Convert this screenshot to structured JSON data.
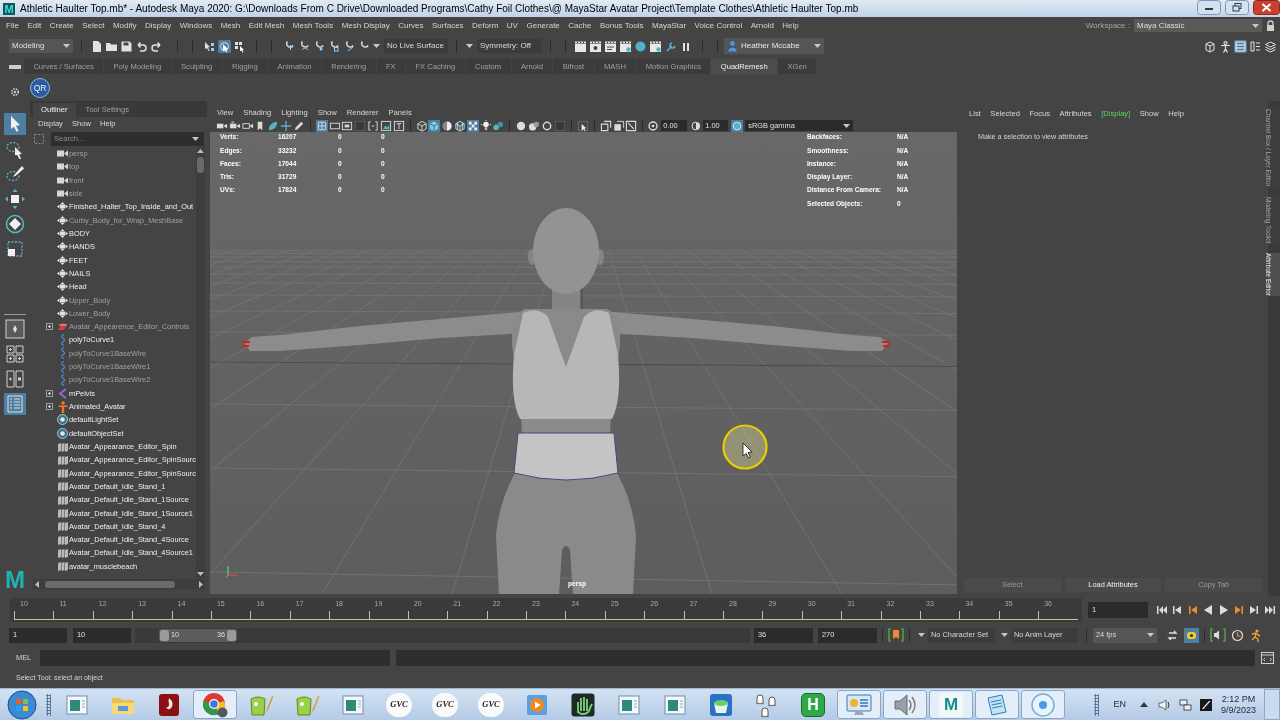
{
  "window": {
    "logo": "M",
    "title": "Athletic Haulter Top.mb* - Autodesk Maya 2020: G:\\Downloads From C Drive\\Downloaded Programs\\Cathy Foil Clothes\\@ MayaStar Avatar Project\\Template Clothes\\Athletic Haulter Top.mb"
  },
  "menu_bar": [
    "File",
    "Edit",
    "Create",
    "Select",
    "Modify",
    "Display",
    "Windows",
    "Mesh",
    "Edit Mesh",
    "Mesh Tools",
    "Mesh Display",
    "Curves",
    "Surfaces",
    "Deform",
    "UV",
    "Generate",
    "Cache",
    "Bonus Tools",
    "MayaStar",
    "Voice Control",
    "Arnold",
    "Help"
  ],
  "workspace": {
    "label": "Workspace :",
    "value": "Maya Classic"
  },
  "status_line": {
    "menu_set": "Modeling",
    "select_modes": [
      {
        "selected": false
      },
      {
        "selected": true
      },
      {
        "selected": false
      }
    ],
    "live_surface": "No Live Surface",
    "symmetry": "Symmetry: Off",
    "user": "Heather Mccabe",
    "panel_toggles": [
      {
        "selected": false
      },
      {
        "selected": false
      },
      {
        "selected": true
      },
      {
        "selected": false
      },
      {
        "selected": false
      }
    ]
  },
  "shelf": {
    "tabs": [
      {
        "label": "Curves / Surfaces",
        "selected": false
      },
      {
        "label": "Poly Modeling",
        "selected": false
      },
      {
        "label": "Sculpting",
        "selected": false
      },
      {
        "label": "Rigging",
        "selected": false
      },
      {
        "label": "Animation",
        "selected": false
      },
      {
        "label": "Rendering",
        "selected": false
      },
      {
        "label": "FX",
        "selected": false
      },
      {
        "label": "FX Caching",
        "selected": false
      },
      {
        "label": "Custom",
        "selected": false
      },
      {
        "label": "Arnold",
        "selected": false
      },
      {
        "label": "Bifrost",
        "selected": false
      },
      {
        "label": "MASH",
        "selected": false
      },
      {
        "label": "Motion Graphics",
        "selected": false
      },
      {
        "label": "QuadRemesh",
        "selected": true
      },
      {
        "label": "XGen",
        "selected": false
      }
    ],
    "buttons": [
      "QR"
    ]
  },
  "toolbox": {
    "tools": [
      {
        "selected": true
      },
      {
        "selected": false
      },
      {
        "selected": false
      },
      {
        "selected": false
      },
      {
        "selected": false
      },
      {
        "selected": false
      }
    ],
    "layouts": [
      {
        "selected": false
      },
      {
        "selected": false
      },
      {
        "selected": false
      },
      {
        "selected": true
      }
    ],
    "logo": "M"
  },
  "outliner": {
    "tabs": [
      {
        "label": "Outliner",
        "selected": true
      },
      {
        "label": "Tool Settings",
        "selected": false
      }
    ],
    "menu": [
      "Display",
      "Show",
      "Help"
    ],
    "search": {
      "placeholder": "Search..."
    },
    "items": [
      {
        "kind": "camera",
        "label": "persp",
        "hidden": true,
        "expandable": false
      },
      {
        "kind": "camera",
        "label": "top",
        "hidden": true,
        "expandable": false
      },
      {
        "kind": "camera",
        "label": "front",
        "hidden": true,
        "expandable": false
      },
      {
        "kind": "camera",
        "label": "side",
        "hidden": true,
        "expandable": false
      },
      {
        "kind": "mesh",
        "label": "Finished_Halter_Top_Inside_and_Out",
        "hidden": false,
        "expandable": false
      },
      {
        "kind": "mesh",
        "label": "Curby_Body_for_Wrap_MeshBase",
        "hidden": true,
        "expandable": false
      },
      {
        "kind": "mesh",
        "label": "BODY",
        "hidden": false,
        "expandable": false
      },
      {
        "kind": "mesh",
        "label": "HANDS",
        "hidden": false,
        "expandable": false
      },
      {
        "kind": "mesh",
        "label": "FEET",
        "hidden": false,
        "expandable": false
      },
      {
        "kind": "mesh",
        "label": "NAILS",
        "hidden": false,
        "expandable": false
      },
      {
        "kind": "mesh",
        "label": "Head",
        "hidden": false,
        "expandable": false
      },
      {
        "kind": "mesh",
        "label": "Upper_Body",
        "hidden": true,
        "expandable": false
      },
      {
        "kind": "mesh",
        "label": "Lower_Body",
        "hidden": true,
        "expandable": false
      },
      {
        "kind": "controls",
        "label": "Avatar_Appearence_Editor_Controls",
        "hidden": true,
        "expandable": true
      },
      {
        "kind": "curve",
        "label": "polyToCurve1",
        "hidden": false,
        "expandable": false
      },
      {
        "kind": "curve",
        "label": "polyToCurve1BaseWire",
        "hidden": true,
        "expandable": false
      },
      {
        "kind": "curve",
        "label": "polyToCurve1BaseWire1",
        "hidden": true,
        "expandable": false
      },
      {
        "kind": "curve",
        "label": "polyToCurve1BaseWire2",
        "hidden": true,
        "expandable": false
      },
      {
        "kind": "joint",
        "label": "mPelvis",
        "hidden": false,
        "expandable": true
      },
      {
        "kind": "figure",
        "label": "Animated_Avatar",
        "hidden": false,
        "expandable": true
      },
      {
        "kind": "set",
        "label": "defaultLightSet",
        "hidden": false,
        "expandable": false
      },
      {
        "kind": "set",
        "label": "defaultObjectSet",
        "hidden": false,
        "expandable": false
      },
      {
        "kind": "anim",
        "label": "Avatar_Appearance_Editor_Spin",
        "hidden": false,
        "expandable": false
      },
      {
        "kind": "anim",
        "label": "Avatar_Appearance_Editor_SpinSourc",
        "hidden": false,
        "expandable": false
      },
      {
        "kind": "anim",
        "label": "Avatar_Appearance_Editor_SpinSourc",
        "hidden": false,
        "expandable": false
      },
      {
        "kind": "anim",
        "label": "Avatar_Default_Idle_Stand_1",
        "hidden": false,
        "expandable": false
      },
      {
        "kind": "anim",
        "label": "Avatar_Default_Idle_Stand_1Source",
        "hidden": false,
        "expandable": false
      },
      {
        "kind": "anim",
        "label": "Avatar_Default_Idle_Stand_1Source1",
        "hidden": false,
        "expandable": false
      },
      {
        "kind": "anim",
        "label": "Avatar_Default_Idle_Stand_4",
        "hidden": false,
        "expandable": false
      },
      {
        "kind": "anim",
        "label": "Avatar_Default_Idle_Stand_4Source",
        "hidden": false,
        "expandable": false
      },
      {
        "kind": "anim",
        "label": "Avatar_Default_Idle_Stand_4Source1",
        "hidden": false,
        "expandable": false
      },
      {
        "kind": "anim",
        "label": "avatar_musclebeach",
        "hidden": false,
        "expandable": false
      }
    ]
  },
  "viewport": {
    "menu": [
      "View",
      "Shading",
      "Lighting",
      "Show",
      "Renderer",
      "Panels"
    ],
    "toolbar": [
      [
        {
          "selected": false
        },
        {
          "selected": false
        },
        {
          "selected": false
        },
        {
          "selected": false
        },
        {
          "selected": false
        },
        {
          "selected": false
        },
        {
          "selected": false
        }
      ],
      [
        {
          "selected": true
        },
        {
          "selected": false
        },
        {
          "selected": false
        },
        {
          "selected": false
        },
        {
          "selected": false
        },
        {
          "selected": false
        },
        {
          "selected": false
        }
      ],
      [
        {
          "selected": false
        },
        {
          "selected": true
        },
        {
          "selected": false
        },
        {
          "selected": false
        },
        {
          "selected": true
        },
        {
          "selected": false
        },
        {
          "selected": false
        }
      ],
      [
        {
          "selected": false
        },
        {
          "selected": false
        },
        {
          "selected": false
        },
        {
          "selected": false
        }
      ],
      [
        {
          "selected": false
        }
      ],
      [
        {
          "selected": false
        },
        {
          "selected": false
        },
        {
          "selected": false
        }
      ]
    ],
    "exposure": "0.00",
    "gamma": "1.00",
    "color_management": true,
    "color_space": "sRGB gamma",
    "stats": [
      {
        "label": "Verts:",
        "values": [
          "16207",
          "0",
          "0"
        ]
      },
      {
        "label": "Edges:",
        "values": [
          "33232",
          "0",
          "0"
        ]
      },
      {
        "label": "Faces:",
        "values": [
          "17044",
          "0",
          "0"
        ]
      },
      {
        "label": "Tris:",
        "values": [
          "31729",
          "0",
          "0"
        ]
      },
      {
        "label": "UVs:",
        "values": [
          "17824",
          "0",
          "0"
        ]
      }
    ],
    "info": [
      {
        "label": "Backfaces:",
        "value": "N/A"
      },
      {
        "label": "Smoothness:",
        "value": "N/A"
      },
      {
        "label": "Instance:",
        "value": "N/A"
      },
      {
        "label": "Display Layer:",
        "value": "N/A"
      },
      {
        "label": "Distance From Camera:",
        "value": "N/A"
      },
      {
        "label": "Selected Objects:",
        "value": "0"
      }
    ],
    "camera": "persp"
  },
  "attribute_editor": {
    "menu": [
      {
        "label": "List",
        "highlighted": false
      },
      {
        "label": "Selected",
        "highlighted": false
      },
      {
        "label": "Focus",
        "highlighted": false
      },
      {
        "label": "Attributes",
        "highlighted": false
      },
      {
        "label": "[Display]",
        "highlighted": true
      },
      {
        "label": "Show",
        "highlighted": false
      },
      {
        "label": "Help",
        "highlighted": false
      }
    ],
    "message": "Make a selection to view attributes",
    "buttons": [
      {
        "label": "Select",
        "disabled": true
      },
      {
        "label": "Load Attributes",
        "disabled": false
      },
      {
        "label": "Copy Tab",
        "disabled": true
      }
    ]
  },
  "side_tabs": [
    {
      "label": "Channel Box / Layer Editor",
      "selected": false
    },
    {
      "label": "Modeling Toolkit",
      "selected": false
    },
    {
      "label": "Attribute Editor",
      "selected": true
    }
  ],
  "time_slider": {
    "ticks": [
      "10",
      "11",
      "12",
      "13",
      "14",
      "15",
      "16",
      "17",
      "18",
      "19",
      "20",
      "21",
      "22",
      "23",
      "24",
      "25",
      "26",
      "27",
      "28",
      "29",
      "30",
      "31",
      "32",
      "33",
      "34",
      "35",
      "36"
    ],
    "current_frame": "1"
  },
  "range_slider": {
    "start": "1",
    "range_start": "10",
    "handle_start": "10",
    "handle_end": "36",
    "range_end": "36",
    "end": "270",
    "character_set": "No Character Set",
    "anim_layer": "No Anim Layer",
    "fps": "24 fps",
    "cache_playback": true
  },
  "command_line": {
    "language": "MEL"
  },
  "help_line": "Select Tool: select an object",
  "taskbar": {
    "items": [
      {
        "kind": "window",
        "open": false
      },
      {
        "kind": "folder",
        "open": false
      },
      {
        "kind": "flame",
        "open": false
      },
      {
        "kind": "browser",
        "open": true
      },
      {
        "kind": "editor",
        "open": false
      },
      {
        "kind": "editor",
        "open": false
      },
      {
        "kind": "window",
        "open": false
      },
      {
        "kind": "gvc",
        "label": "GVC",
        "open": false
      },
      {
        "kind": "gvc",
        "label": "GVC",
        "open": false
      },
      {
        "kind": "gvc",
        "label": "GVC",
        "open": false
      },
      {
        "kind": "player",
        "open": false
      },
      {
        "kind": "hand",
        "open": false
      },
      {
        "kind": "window",
        "open": false
      },
      {
        "kind": "window",
        "open": false
      },
      {
        "kind": "cup",
        "open": false
      },
      {
        "kind": "ghosts",
        "open": false
      },
      {
        "kind": "letter",
        "label": "H",
        "open": false
      },
      {
        "kind": "panel",
        "open": true
      },
      {
        "kind": "speaker",
        "open": true
      },
      {
        "kind": "maya",
        "label": "M",
        "open": true
      },
      {
        "kind": "notepad",
        "open": true
      },
      {
        "kind": "disc",
        "open": true
      }
    ],
    "language": "EN",
    "time": "2:12 PM",
    "date": "9/9/2023"
  }
}
